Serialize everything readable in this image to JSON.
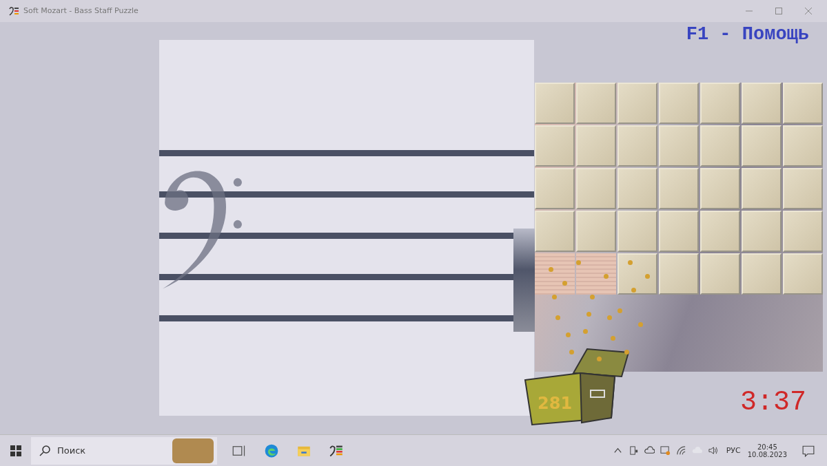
{
  "window": {
    "title": "Soft Mozart - Bass Staff Puzzle"
  },
  "help_hint": "F1 - Помощь",
  "tile_grid": {
    "rows": [
      {
        "tiles": [
          {
            "covered": true
          },
          {
            "covered": true
          },
          {
            "covered": true
          },
          {
            "covered": true
          },
          {
            "covered": true
          },
          {
            "covered": true
          },
          {
            "covered": true
          }
        ]
      },
      {
        "tiles": [
          {
            "covered": true
          },
          {
            "covered": true
          },
          {
            "covered": true
          },
          {
            "covered": true
          },
          {
            "covered": true
          },
          {
            "covered": true
          },
          {
            "covered": true
          }
        ]
      },
      {
        "tiles": [
          {
            "covered": true
          },
          {
            "covered": true
          },
          {
            "covered": true
          },
          {
            "covered": true
          },
          {
            "covered": true
          },
          {
            "covered": true
          },
          {
            "covered": true
          }
        ]
      },
      {
        "tiles": [
          {
            "covered": true
          },
          {
            "covered": true
          },
          {
            "covered": true
          },
          {
            "covered": true
          },
          {
            "covered": true
          },
          {
            "covered": true
          },
          {
            "covered": true
          }
        ]
      },
      {
        "tiles": [
          {
            "covered": false
          },
          {
            "covered": false
          },
          {
            "covered": true
          },
          {
            "covered": true
          },
          {
            "covered": true
          },
          {
            "covered": true
          },
          {
            "covered": true
          }
        ]
      }
    ]
  },
  "score": "281",
  "timer": "3:37",
  "taskbar": {
    "search": {
      "placeholder": "Поиск"
    },
    "language": "РУС",
    "time": "20:45",
    "date": "10.08.2023"
  }
}
